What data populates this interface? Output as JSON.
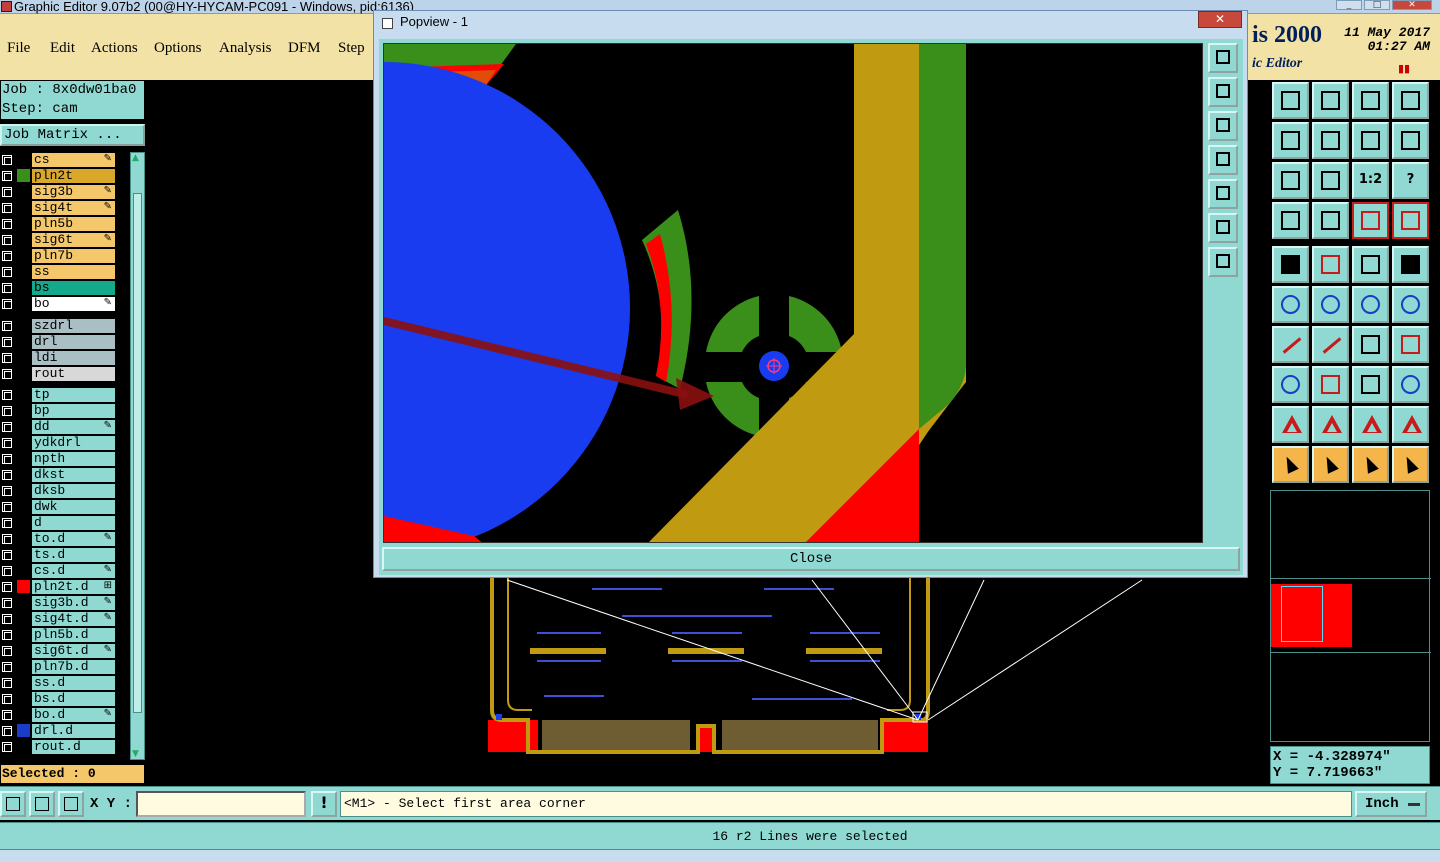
{
  "window": {
    "title": "Graphic Editor 9.07b2 (00@HY-HYCAM-PC091 - Windows, pid:6136)"
  },
  "menu": {
    "items": [
      "File",
      "Edit",
      "Actions",
      "Options",
      "Analysis",
      "DFM",
      "Step"
    ]
  },
  "brand": {
    "name": "is 2000",
    "subtitle": "ic Editor",
    "date": "11 May 2017",
    "time": "01:27 AM"
  },
  "job": {
    "job_label": "Job : 8x0dw01ba0",
    "step_label": "Step: cam",
    "matrix_button": "Job Matrix ..."
  },
  "layers": [
    {
      "name": "cs",
      "color": "#f4c76a",
      "swatch": "#000000",
      "mark": "✎"
    },
    {
      "name": "pln2t",
      "color": "#d9a72a",
      "swatch": "#3a8f1a",
      "mark": ""
    },
    {
      "name": "sig3b",
      "color": "#f4c76a",
      "swatch": "#000000",
      "mark": "✎"
    },
    {
      "name": "sig4t",
      "color": "#f4c76a",
      "swatch": "#000000",
      "mark": "✎"
    },
    {
      "name": "pln5b",
      "color": "#f4c76a",
      "swatch": "#000000",
      "mark": ""
    },
    {
      "name": "sig6t",
      "color": "#f4c76a",
      "swatch": "#000000",
      "mark": "✎"
    },
    {
      "name": "pln7b",
      "color": "#f4c76a",
      "swatch": "#000000",
      "mark": ""
    },
    {
      "name": "ss",
      "color": "#f4c76a",
      "swatch": "#000000",
      "mark": ""
    },
    {
      "name": "bs",
      "color": "#13a98a",
      "swatch": "#000000",
      "mark": ""
    },
    {
      "name": "bo",
      "color": "#ffffff",
      "swatch": "#000000",
      "mark": "✎"
    },
    {
      "name": "szdrl",
      "color": "#a9bfc4",
      "swatch": "#000000",
      "mark": ""
    },
    {
      "name": "drl",
      "color": "#a9bfc4",
      "swatch": "#000000",
      "mark": ""
    },
    {
      "name": "ldi",
      "color": "#a9bfc4",
      "swatch": "#000000",
      "mark": ""
    },
    {
      "name": "rout",
      "color": "#d8d8d8",
      "swatch": "#000000",
      "mark": ""
    },
    {
      "name": "tp",
      "color": "#8fd9d2",
      "swatch": "#000000",
      "mark": ""
    },
    {
      "name": "bp",
      "color": "#8fd9d2",
      "swatch": "#000000",
      "mark": ""
    },
    {
      "name": "dd",
      "color": "#8fd9d2",
      "swatch": "#000000",
      "mark": "✎"
    },
    {
      "name": "ydkdrl",
      "color": "#8fd9d2",
      "swatch": "#000000",
      "mark": ""
    },
    {
      "name": "npth",
      "color": "#8fd9d2",
      "swatch": "#000000",
      "mark": ""
    },
    {
      "name": "dkst",
      "color": "#8fd9d2",
      "swatch": "#000000",
      "mark": ""
    },
    {
      "name": "dksb",
      "color": "#8fd9d2",
      "swatch": "#000000",
      "mark": ""
    },
    {
      "name": "dwk",
      "color": "#8fd9d2",
      "swatch": "#000000",
      "mark": ""
    },
    {
      "name": "d",
      "color": "#8fd9d2",
      "swatch": "#000000",
      "mark": ""
    },
    {
      "name": "to.d",
      "color": "#8fd9d2",
      "swatch": "#000000",
      "mark": "✎"
    },
    {
      "name": "ts.d",
      "color": "#8fd9d2",
      "swatch": "#000000",
      "mark": ""
    },
    {
      "name": "cs.d",
      "color": "#8fd9d2",
      "swatch": "#000000",
      "mark": "✎"
    },
    {
      "name": "pln2t.d",
      "color": "#8fd9d2",
      "swatch": "#ff0000",
      "mark": "⊞"
    },
    {
      "name": "sig3b.d",
      "color": "#8fd9d2",
      "swatch": "#000000",
      "mark": "✎"
    },
    {
      "name": "sig4t.d",
      "color": "#8fd9d2",
      "swatch": "#000000",
      "mark": "✎"
    },
    {
      "name": "pln5b.d",
      "color": "#8fd9d2",
      "swatch": "#000000",
      "mark": ""
    },
    {
      "name": "sig6t.d",
      "color": "#8fd9d2",
      "swatch": "#000000",
      "mark": "✎"
    },
    {
      "name": "pln7b.d",
      "color": "#8fd9d2",
      "swatch": "#000000",
      "mark": ""
    },
    {
      "name": "ss.d",
      "color": "#8fd9d2",
      "swatch": "#000000",
      "mark": ""
    },
    {
      "name": "bs.d",
      "color": "#8fd9d2",
      "swatch": "#000000",
      "mark": ""
    },
    {
      "name": "bo.d",
      "color": "#8fd9d2",
      "swatch": "#000000",
      "mark": "✎"
    },
    {
      "name": "drl.d",
      "color": "#8fd9d2",
      "swatch": "#1a3cc8",
      "mark": ""
    },
    {
      "name": "rout.d",
      "color": "#8fd9d2",
      "swatch": "#000000",
      "mark": ""
    }
  ],
  "selected": "Selected : 0",
  "popup": {
    "title": "Popview - 1",
    "close_label": "Close",
    "close_x": "✕"
  },
  "toolbar_right": {
    "ratio_label": "1:2",
    "help_label": "?"
  },
  "coords": {
    "x": "X = -4.328974\"",
    "y": "Y = 7.719663\""
  },
  "command": {
    "xy_label": "X Y :",
    "xy_value": "",
    "excl_label": "!",
    "message": "<M1> - Select first area corner",
    "unit": "Inch"
  },
  "status": {
    "text": "16 r2 Lines were selected"
  },
  "colors": {
    "panel": "#8fd9d2",
    "copper": "#c09a10",
    "green": "#3a8f1a",
    "red": "#ff0000",
    "blue": "#1a3cf0"
  }
}
